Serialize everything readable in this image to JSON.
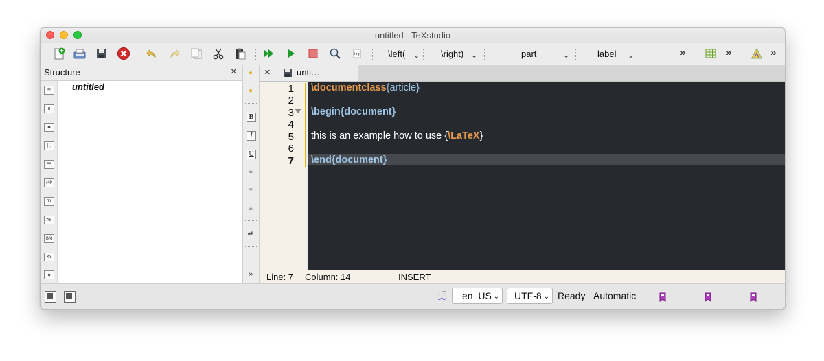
{
  "window": {
    "title": "untitled - TeXstudio"
  },
  "toolbar": {
    "combo_left": "\\left(",
    "combo_right": "\\right)",
    "combo_part": "part",
    "combo_label": "label",
    "overflow_glyph": "»"
  },
  "structure": {
    "title": "Structure",
    "close_glyph": "×",
    "root_item": "untitled",
    "side_icons": [
      "PS",
      "MP",
      "TI",
      "AS",
      "BM",
      "XY"
    ]
  },
  "tabs": [
    {
      "label": "unti…",
      "close_glyph": "×"
    }
  ],
  "editor": {
    "line_numbers": [
      "1",
      "2",
      "3",
      "4",
      "5",
      "6",
      "7"
    ],
    "active_line": 7,
    "lines": [
      {
        "cmd": "\\documentclass",
        "open": "{",
        "arg": "article",
        "close": "}"
      },
      {
        "text": ""
      },
      {
        "cmd": "\\begin",
        "envarg": "{document}"
      },
      {
        "text": ""
      },
      {
        "text": "this is an example how to use {",
        "cmd": "\\LaTeX",
        "close": "}"
      },
      {
        "text": ""
      },
      {
        "cmd": "\\end",
        "envarg": "{document}"
      }
    ]
  },
  "statusline": {
    "line": "Line: 7",
    "column": "Column: 14",
    "mode": "INSERT"
  },
  "statusbar": {
    "lt_label": "LT",
    "language": "en_US",
    "encoding": "UTF-8",
    "status": "Ready",
    "mode": "Automatic"
  },
  "colors": {
    "editor_bg": "#262a2e",
    "keyword": "#e59a4e",
    "argument": "#9fc4e4",
    "gutter_bg": "#f5f1e8",
    "fold_marker": "#e8b400"
  }
}
